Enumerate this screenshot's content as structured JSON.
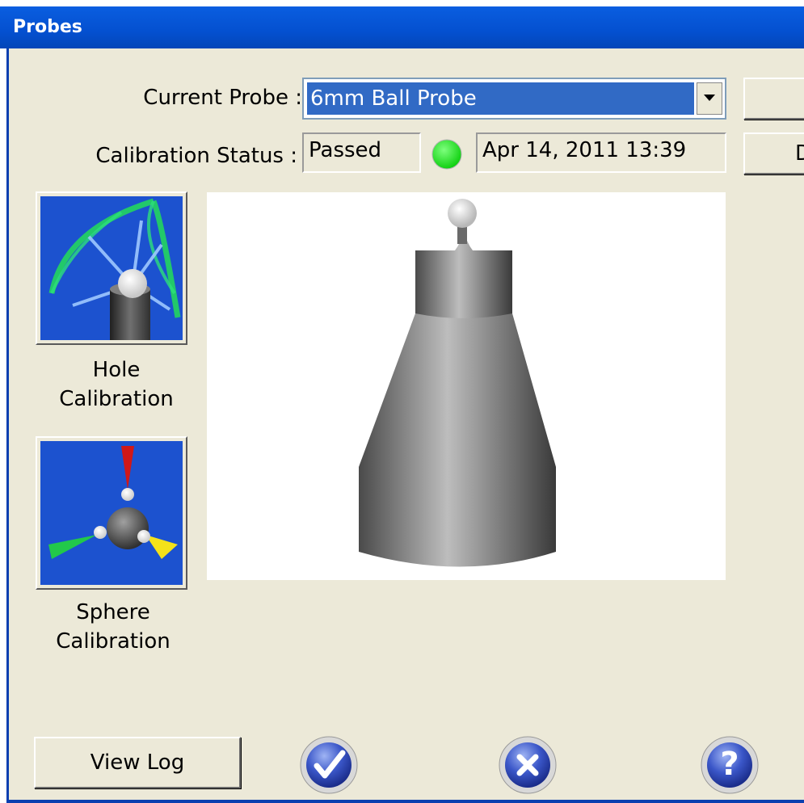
{
  "window": {
    "title": "Probes"
  },
  "probe": {
    "label": "Current Probe :",
    "selected": "6mm Ball Probe"
  },
  "calibration": {
    "label": "Calibration Status :",
    "status": "Passed",
    "status_color": "#18e018",
    "date": "Apr 14, 2011 13:39"
  },
  "side_buttons": {
    "second_partial": "D"
  },
  "tools": [
    {
      "line1": "Hole",
      "line2": "Calibration",
      "icon": "hole-calibration-icon"
    },
    {
      "line1": "Sphere",
      "line2": "Calibration",
      "icon": "sphere-calibration-icon"
    }
  ],
  "preview": {
    "image": "ball-probe-image"
  },
  "footer": {
    "view_log": "View Log",
    "ok_icon": "checkmark-icon",
    "cancel_icon": "close-icon",
    "help_icon": "help-icon",
    "help_glyph": "?"
  }
}
